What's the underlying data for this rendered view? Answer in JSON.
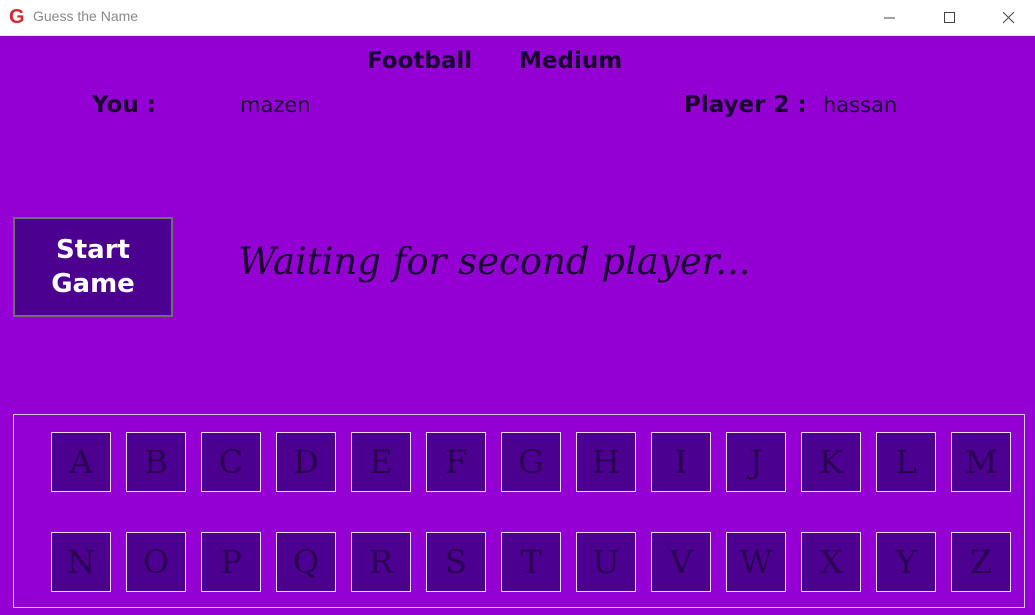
{
  "window": {
    "title": "Guess the Name",
    "logo_letter": "G"
  },
  "game": {
    "category": "Football",
    "difficulty": "Medium",
    "you_label": "You :",
    "you_name": "mazen",
    "player2_label": "Player 2 :",
    "player2_name": "hassan",
    "start_button_line1": "Start",
    "start_button_line2": "Game",
    "status": "Waiting for second player...",
    "colors": {
      "background": "#9400d3",
      "button": "#4b0090",
      "text": "#1a0030"
    }
  },
  "keyboard": {
    "row1": [
      "A",
      "B",
      "C",
      "D",
      "E",
      "F",
      "G",
      "H",
      "I",
      "J",
      "K",
      "L",
      "M"
    ],
    "row2": [
      "N",
      "O",
      "P",
      "Q",
      "R",
      "S",
      "T",
      "U",
      "V",
      "W",
      "X",
      "Y",
      "Z"
    ]
  }
}
